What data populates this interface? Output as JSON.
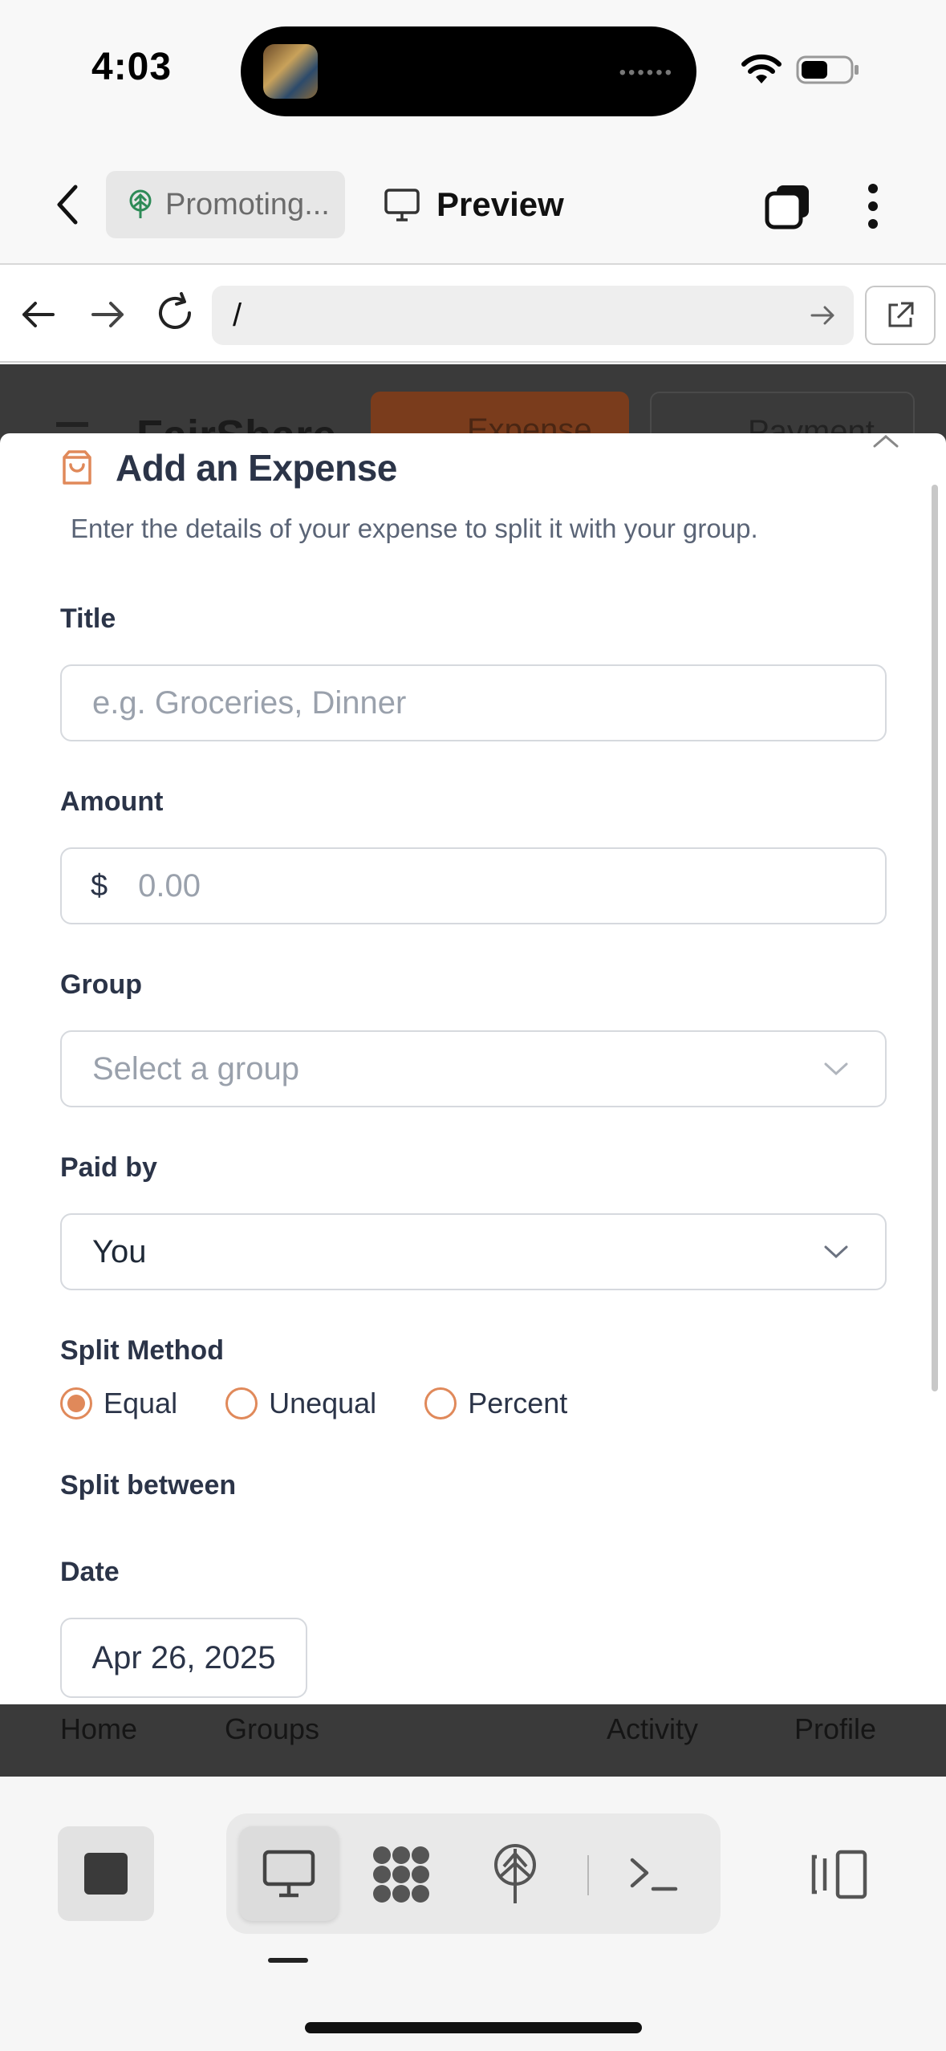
{
  "status_bar": {
    "time": "4:03"
  },
  "header": {
    "project_label": "Promoting...",
    "preview_label": "Preview"
  },
  "url_bar": {
    "url": "/"
  },
  "underlay": {
    "brand": "FairShare",
    "expense_button": "Expense",
    "payment_button": "Payment",
    "nav": {
      "home": "Home",
      "groups": "Groups",
      "activity": "Activity",
      "profile": "Profile"
    }
  },
  "form": {
    "title": "Add an Expense",
    "subtitle": "Enter the details of your expense to split it with your group.",
    "title_label": "Title",
    "title_placeholder": "e.g. Groceries, Dinner",
    "amount_label": "Amount",
    "currency_symbol": "$",
    "amount_placeholder": "0.00",
    "group_label": "Group",
    "group_placeholder": "Select a group",
    "paid_by_label": "Paid by",
    "paid_by_value": "You",
    "split_method_label": "Split Method",
    "split_options": [
      {
        "label": "Equal",
        "selected": true
      },
      {
        "label": "Unequal",
        "selected": false
      },
      {
        "label": "Percent",
        "selected": false
      }
    ],
    "split_between_label": "Split between",
    "date_label": "Date",
    "date_value": "Apr 26, 2025"
  },
  "colors": {
    "accent": "#e0895a",
    "label_text": "#2b3448",
    "placeholder": "#9aa1ac",
    "border": "#d6d9de"
  },
  "toolbar": {
    "icons": [
      "stop-icon",
      "monitor-icon",
      "grid-dots-icon",
      "globe-upload-icon",
      "terminal-icon",
      "split-panel-icon"
    ]
  }
}
